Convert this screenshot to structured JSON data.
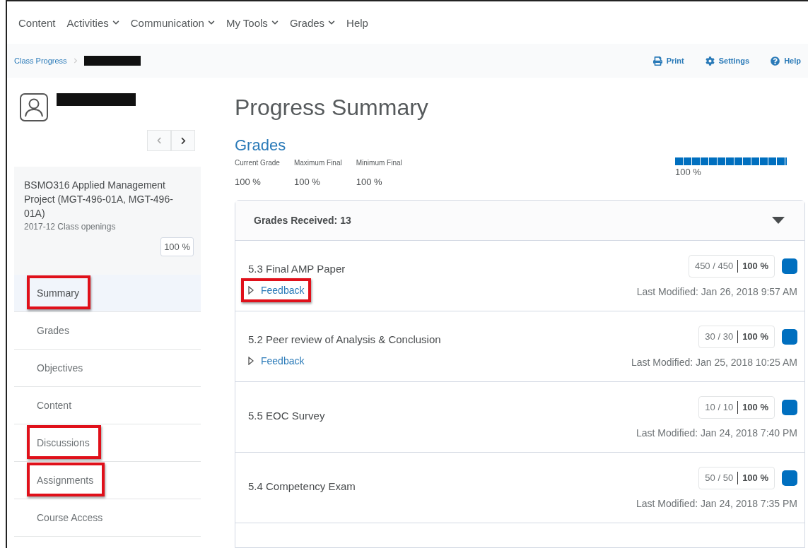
{
  "top_nav": [
    {
      "label": "Content",
      "has_menu": false
    },
    {
      "label": "Activities",
      "has_menu": true
    },
    {
      "label": "Communication",
      "has_menu": true
    },
    {
      "label": "My Tools",
      "has_menu": true
    },
    {
      "label": "Grades",
      "has_menu": true
    },
    {
      "label": "Help",
      "has_menu": false
    }
  ],
  "breadcrumb": {
    "link": "Class Progress",
    "redacted": true
  },
  "page_actions": [
    {
      "kind": "print",
      "label": "Print"
    },
    {
      "kind": "settings",
      "label": "Settings"
    },
    {
      "kind": "help",
      "label": "Help"
    }
  ],
  "student": {
    "redacted": true
  },
  "course": {
    "title": "BSMO316 Applied Management Project (MGT-496-01A, MGT-496-01A)",
    "term": "2017-12 Class openings",
    "grade": "100 %"
  },
  "sidebar_nav": [
    {
      "label": "Summary",
      "selected": true,
      "highlighted": true
    },
    {
      "label": "Grades",
      "selected": false,
      "highlighted": false
    },
    {
      "label": "Objectives",
      "selected": false,
      "highlighted": false
    },
    {
      "label": "Content",
      "selected": false,
      "highlighted": false
    },
    {
      "label": "Discussions",
      "selected": false,
      "highlighted": true
    },
    {
      "label": "Assignments",
      "selected": false,
      "highlighted": true
    },
    {
      "label": "Course Access",
      "selected": false,
      "highlighted": false
    }
  ],
  "title": "Progress Summary",
  "grades": {
    "heading": "Grades",
    "stats": [
      {
        "label": "Current Grade",
        "value": "100 %"
      },
      {
        "label": "Maximum Final",
        "value": "100 %"
      },
      {
        "label": "Minimum Final",
        "value": "100 %"
      }
    ],
    "meter": {
      "level": 1.0,
      "reading": "100 %"
    },
    "received": {
      "label": "Grades Received: 13",
      "expanded": true
    },
    "items": [
      {
        "title": "5.3 Final AMP Paper",
        "feedback": "Feedback",
        "feedback_highlighted": true,
        "points": "450 / 450",
        "percent": "100 %",
        "modified": "Last Modified: Jan 26, 2018 9:57 AM"
      },
      {
        "title": "5.2 Peer review of Analysis & Conclusion",
        "feedback": "Feedback",
        "feedback_highlighted": false,
        "points": "30 / 30",
        "percent": "100 %",
        "modified": "Last Modified: Jan 25, 2018 10:25 AM"
      },
      {
        "title": "5.5 EOC Survey",
        "points": "10 / 10",
        "percent": "100 %",
        "modified": "Last Modified: Jan 24, 2018 7:40 PM"
      },
      {
        "title": "5.4 Competency Exam",
        "points": "50 / 50",
        "percent": "100 %",
        "modified": "Last Modified: Jan 24, 2018 7:35 PM"
      }
    ]
  }
}
